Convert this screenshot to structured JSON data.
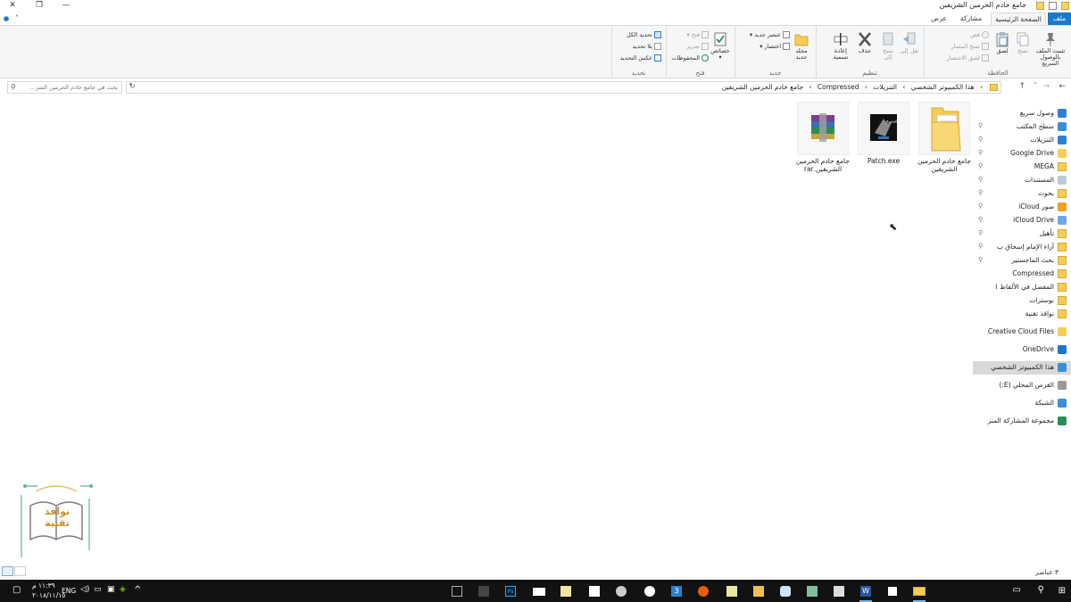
{
  "window": {
    "title": "جامع خادم الحرمين الشريفين",
    "controls": [
      "✕",
      "❐",
      "—"
    ]
  },
  "ribbon_tabs": [
    "ملف",
    "الصفحة الرئيسية",
    "مشاركة",
    "عرض"
  ],
  "ribbon": {
    "clipboard": {
      "label": "الحافظة",
      "pin": "تثبيت الملف بالوصول السريع",
      "copy": "نسخ",
      "paste": "لصق",
      "cut": "قص",
      "copy_path": "نسخ المسار",
      "paste_shortcut": "لصق الاختصار"
    },
    "organize": {
      "label": "تنظيم",
      "move_to": "نقل إلى",
      "copy_to": "نسخ إلى",
      "delete": "حذف",
      "rename": "إعادة تسمية"
    },
    "new": {
      "label": "جديد",
      "new_folder": "مجلد جديد",
      "new_item": "عنصر جديد",
      "easy_access": "اختصار"
    },
    "open": {
      "label": "فتح",
      "properties": "خصائص",
      "open": "فتح",
      "edit": "تحرير",
      "history": "المحفوظات"
    },
    "select": {
      "label": "تحديد",
      "select_all": "تحديد الكل",
      "select_none": "بلا تحديد",
      "invert": "عكس التحديد"
    }
  },
  "address": {
    "crumbs": [
      "هذا الكمبيوتر الشخصي",
      "التنزيلات",
      "Compressed",
      "جامع خادم الحرمين الشريفين"
    ],
    "search_placeholder": "بحث في جامع خادم الحرمين الشر..."
  },
  "nav_pane": [
    {
      "label": "وصول سريع",
      "icon": "star-icon",
      "pin": false
    },
    {
      "label": "سطح المكتب",
      "icon": "desktop-icon",
      "pin": true
    },
    {
      "label": "التنزيلات",
      "icon": "download-icon",
      "pin": true
    },
    {
      "label": "Google Drive",
      "icon": "google-drive-icon",
      "pin": true
    },
    {
      "label": "MEGA",
      "icon": "folder-icon",
      "pin": true
    },
    {
      "label": "المستندات",
      "icon": "documents-icon",
      "pin": true
    },
    {
      "label": "بحوث",
      "icon": "folder-icon",
      "pin": true
    },
    {
      "label": "صور iCloud",
      "icon": "icloud-photos-icon",
      "pin": true
    },
    {
      "label": "iCloud Drive",
      "icon": "icloud-icon",
      "pin": true
    },
    {
      "label": "تأهيل",
      "icon": "folder-icon",
      "pin": true
    },
    {
      "label": "آراء الإمام إسحاق ب",
      "icon": "folder-icon",
      "pin": true
    },
    {
      "label": "بحث الماجستير",
      "icon": "folder-icon",
      "pin": true
    },
    {
      "label": "Compressed",
      "icon": "folder-icon",
      "pin": false
    },
    {
      "label": "المفصل في الألفاظ ا",
      "icon": "folder-icon",
      "pin": false
    },
    {
      "label": "بوسترات",
      "icon": "folder-icon",
      "pin": false
    },
    {
      "label": "نوافذ تقنية",
      "icon": "folder-icon",
      "pin": false
    },
    {
      "label": "Creative Cloud Files",
      "icon": "creative-cloud-icon",
      "pin": false
    },
    {
      "label": "OneDrive",
      "icon": "onedrive-icon",
      "pin": false
    },
    {
      "label": "هذا الكمبيوتر الشخصي",
      "icon": "computer-icon",
      "pin": false,
      "selected": true
    },
    {
      "label": "القرص المحلي (E:)",
      "icon": "drive-icon",
      "pin": false
    },
    {
      "label": "الشبكة",
      "icon": "network-icon",
      "pin": false
    },
    {
      "label": "مجموعة المشاركة المنز",
      "icon": "homegroup-icon",
      "pin": false
    }
  ],
  "files": [
    {
      "name": "جامع خادم الحرمين الشريفين",
      "type": "folder"
    },
    {
      "name": "Patch.exe",
      "type": "exe"
    },
    {
      "name": "جامع خادم الحرمين الشريفين.rar",
      "type": "rar"
    }
  ],
  "status": {
    "items_count": "٣ عناصر"
  },
  "taskbar": {
    "time": "١١:٣٩ م",
    "date": "٢٠١٨/١١/١٥",
    "language": "ENG"
  },
  "logo": {
    "text": "نوافذ تقنية"
  },
  "colors": {
    "accent": "#1979ca",
    "folder": "#f6cc54",
    "taskbar": "#121212"
  }
}
